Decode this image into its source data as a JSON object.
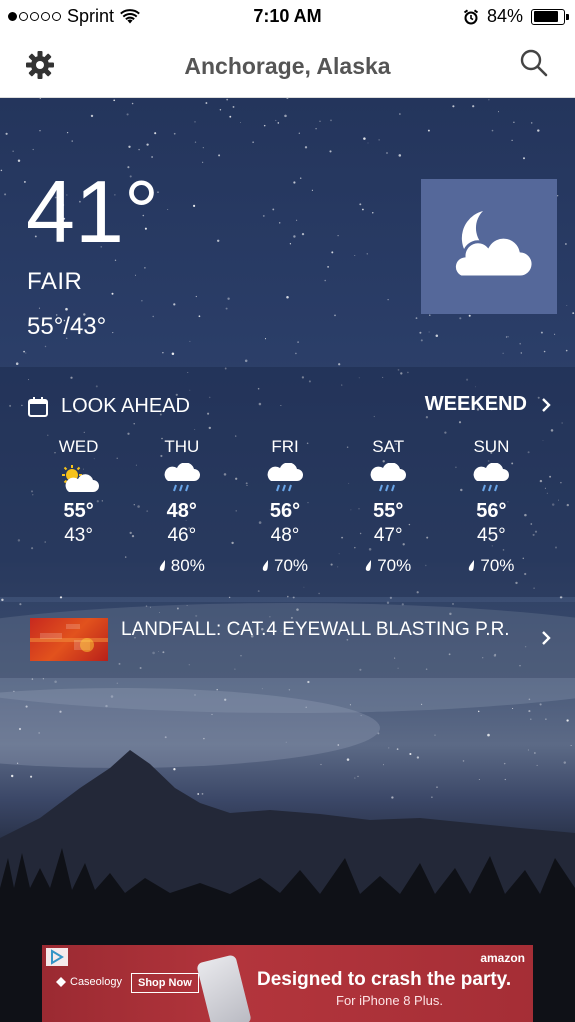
{
  "status_bar": {
    "carrier": "Sprint",
    "time": "7:10 AM",
    "battery_percent": "84%",
    "battery_level": 0.84,
    "signal_bars_filled": 1,
    "signal_bars_total": 5
  },
  "header": {
    "location": "Anchorage, Alaska",
    "settings_icon": "gear-icon",
    "search_icon": "search-icon"
  },
  "current": {
    "temperature": "41°",
    "condition": "FAIR",
    "hi_lo": "55°/43°",
    "icon": "moon-cloud-icon"
  },
  "look_ahead": {
    "label": "LOOK AHEAD",
    "weekend_label": "WEEKEND",
    "days": [
      {
        "name": "WED",
        "hi": "55°",
        "lo": "43°",
        "precip": "",
        "icon": "sun-cloud-icon"
      },
      {
        "name": "THU",
        "hi": "48°",
        "lo": "46°",
        "precip": "80%",
        "icon": "rain-cloud-icon"
      },
      {
        "name": "FRI",
        "hi": "56°",
        "lo": "48°",
        "precip": "70%",
        "icon": "rain-cloud-icon"
      },
      {
        "name": "SAT",
        "hi": "55°",
        "lo": "47°",
        "precip": "70%",
        "icon": "rain-cloud-icon"
      },
      {
        "name": "SUN",
        "hi": "56°",
        "lo": "45°",
        "precip": "70%",
        "icon": "rain-cloud-icon"
      }
    ]
  },
  "news": {
    "title": "LANDFALL: CAT.4 EYEWALL BLASTING P.R."
  },
  "ad": {
    "brand": "Caseology",
    "button": "Shop Now",
    "sponsor": "amazon",
    "headline": "Designed to crash the party.",
    "subline": "For iPhone 8 Plus."
  }
}
